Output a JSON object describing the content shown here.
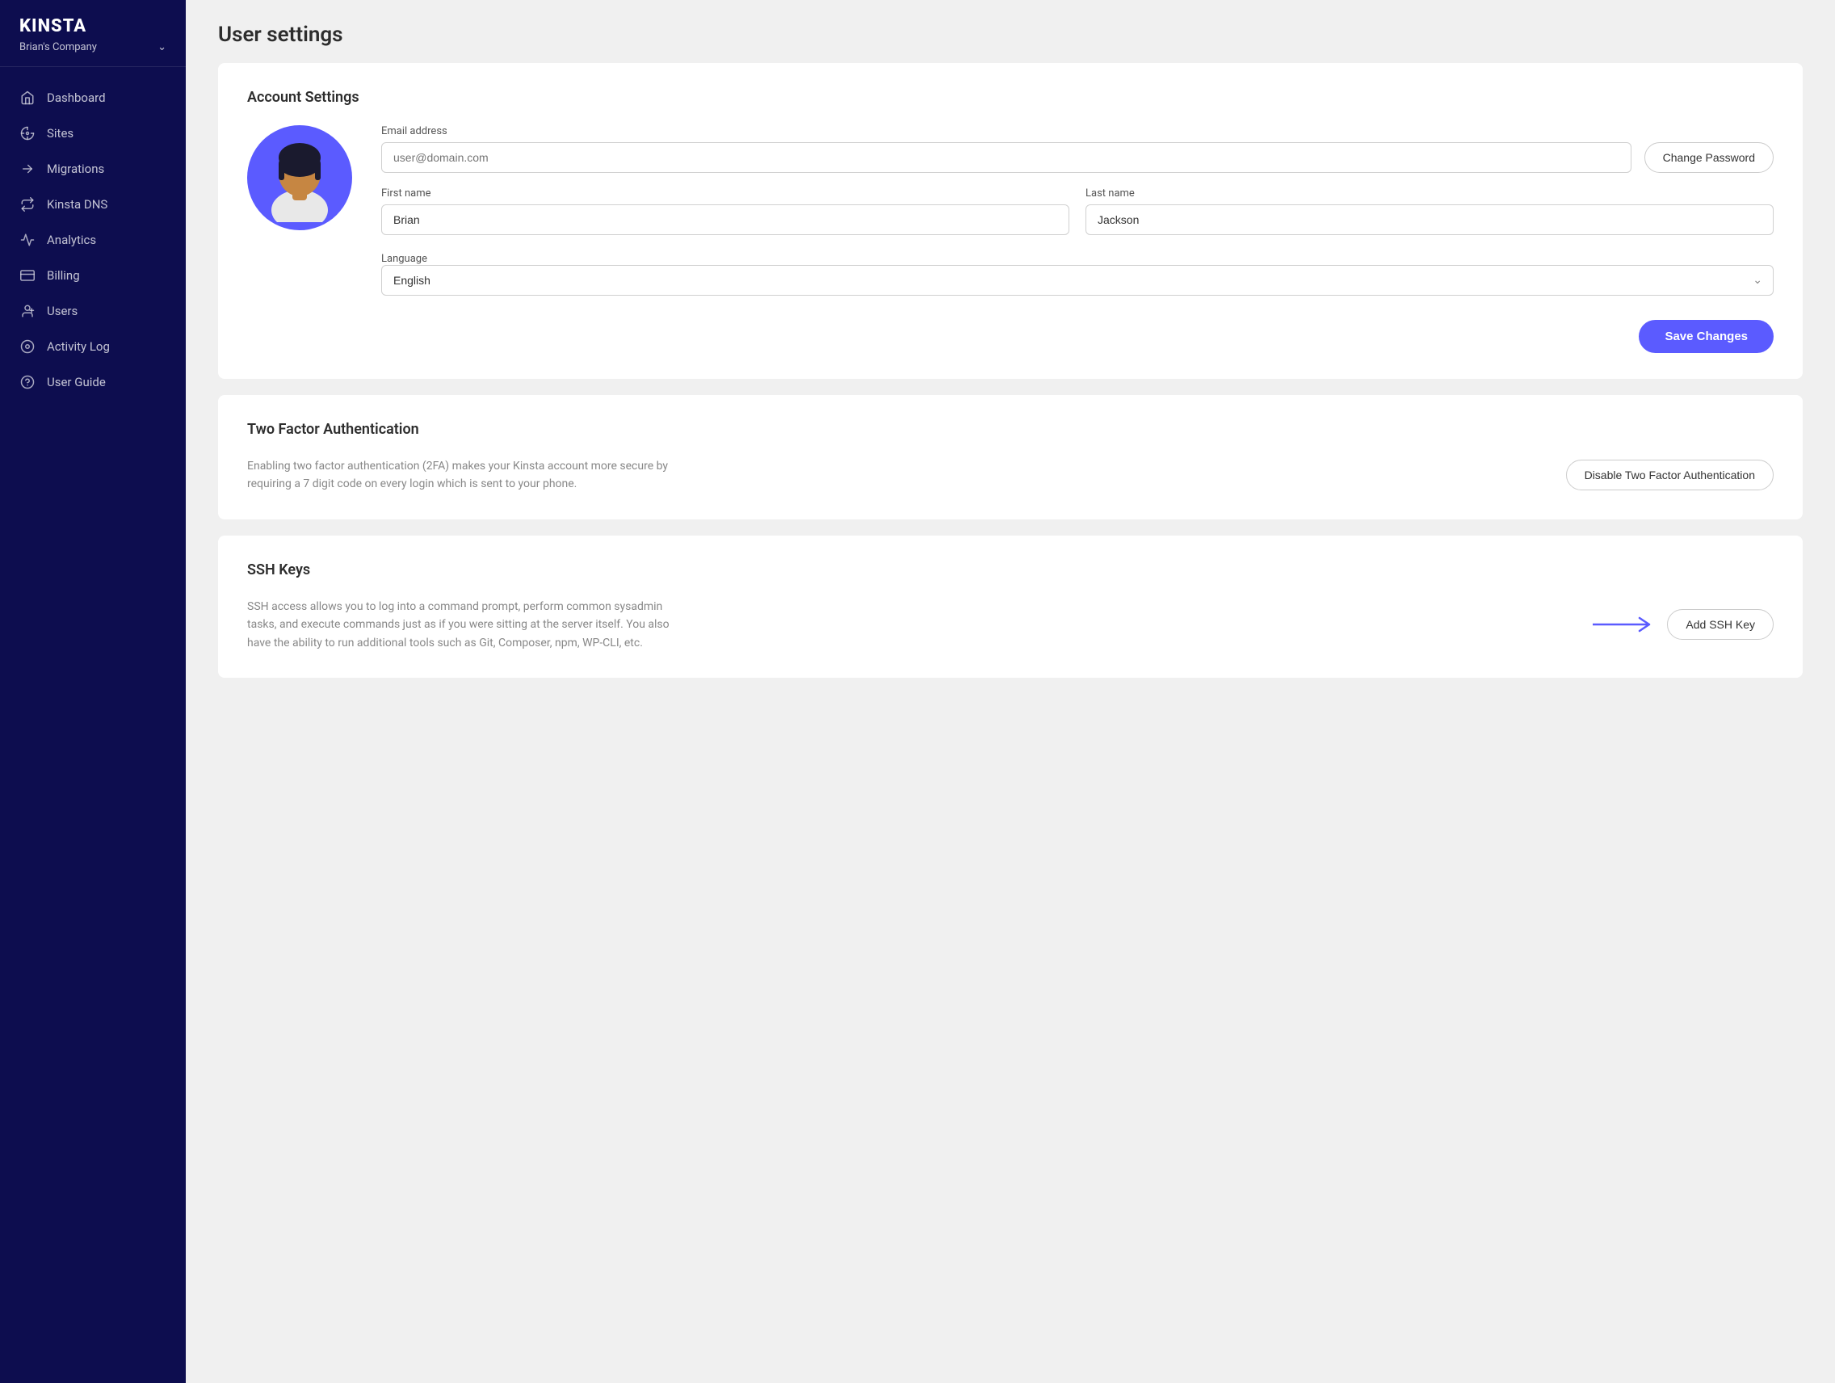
{
  "app": {
    "logo": "KINSTA",
    "company": "Brian's Company"
  },
  "sidebar": {
    "items": [
      {
        "id": "dashboard",
        "label": "Dashboard",
        "icon": "⌂"
      },
      {
        "id": "sites",
        "label": "Sites",
        "icon": "◈"
      },
      {
        "id": "migrations",
        "label": "Migrations",
        "icon": "➤"
      },
      {
        "id": "kinsta-dns",
        "label": "Kinsta DNS",
        "icon": "⇄"
      },
      {
        "id": "analytics",
        "label": "Analytics",
        "icon": "↗"
      },
      {
        "id": "billing",
        "label": "Billing",
        "icon": "▭"
      },
      {
        "id": "users",
        "label": "Users",
        "icon": "👤"
      },
      {
        "id": "activity-log",
        "label": "Activity Log",
        "icon": "👁"
      },
      {
        "id": "user-guide",
        "label": "User Guide",
        "icon": "?"
      }
    ]
  },
  "page": {
    "title": "User settings"
  },
  "account_settings": {
    "section_title": "Account Settings",
    "email_label": "Email address",
    "email_placeholder": "user@domain.com",
    "change_password_label": "Change Password",
    "first_name_label": "First name",
    "first_name_value": "Brian",
    "last_name_label": "Last name",
    "last_name_value": "Jackson",
    "language_label": "Language",
    "language_value": "English",
    "save_label": "Save Changes"
  },
  "two_factor": {
    "section_title": "Two Factor Authentication",
    "description": "Enabling two factor authentication (2FA) makes your Kinsta account more secure by requiring a 7 digit code on every login which is sent to your phone.",
    "disable_label": "Disable Two Factor Authentication"
  },
  "ssh_keys": {
    "section_title": "SSH Keys",
    "description": "SSH access allows you to log into a command prompt, perform common sysadmin tasks, and execute commands just as if you were sitting at the server itself. You also have the ability to run additional tools such as Git, Composer, npm, WP-CLI, etc.",
    "add_label": "Add SSH Key"
  }
}
